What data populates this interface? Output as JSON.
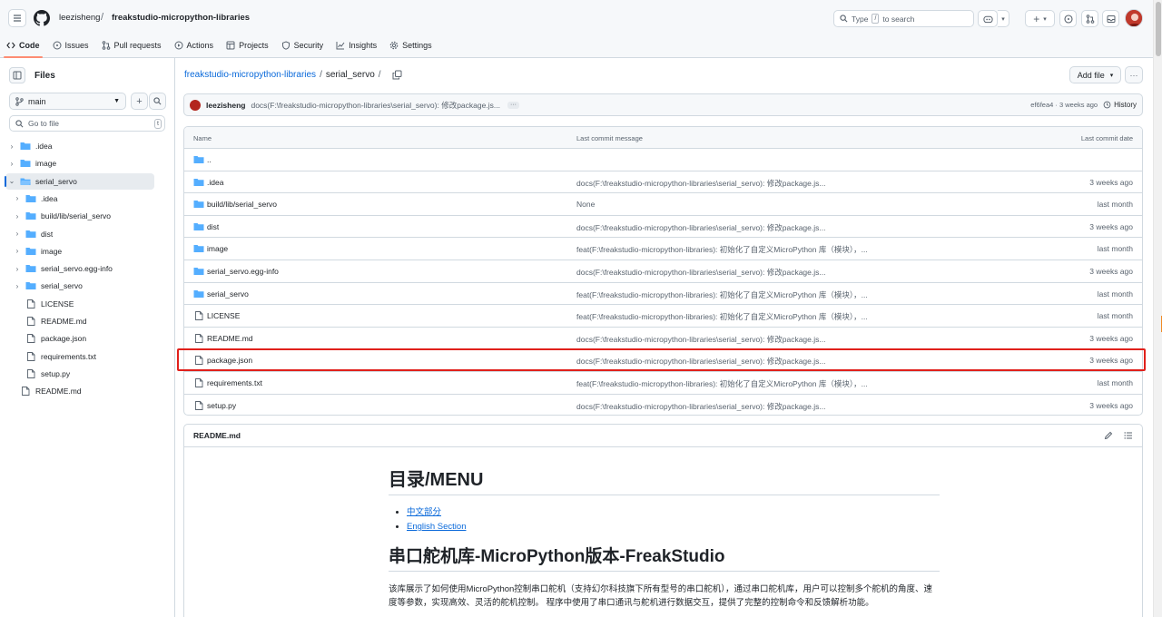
{
  "header": {
    "owner": "leezisheng",
    "separator": "/",
    "repo": "freakstudio-micropython-libraries",
    "search_prefix": "Type",
    "search_key": "/",
    "search_suffix": "to search"
  },
  "nav": [
    {
      "label": "Code",
      "icon": "code-icon",
      "active": true
    },
    {
      "label": "Issues",
      "icon": "issue-icon"
    },
    {
      "label": "Pull requests",
      "icon": "pull-request-icon"
    },
    {
      "label": "Actions",
      "icon": "play-icon"
    },
    {
      "label": "Projects",
      "icon": "table-icon"
    },
    {
      "label": "Security",
      "icon": "shield-icon"
    },
    {
      "label": "Insights",
      "icon": "graph-icon"
    },
    {
      "label": "Settings",
      "icon": "gear-icon"
    }
  ],
  "sidebar": {
    "title": "Files",
    "branch": "main",
    "goto_placeholder": "Go to file",
    "goto_key": "t",
    "tree": [
      {
        "label": ".idea",
        "type": "folder",
        "level": 0,
        "chevron": "›"
      },
      {
        "label": "image",
        "type": "folder",
        "level": 0,
        "chevron": "›"
      },
      {
        "label": "serial_servo",
        "type": "folder-open",
        "level": 0,
        "chevron": "⌄",
        "selected": true
      },
      {
        "label": ".idea",
        "type": "folder",
        "level": 1,
        "chevron": "›"
      },
      {
        "label": "build/lib/serial_servo",
        "type": "folder",
        "level": 1,
        "chevron": "›"
      },
      {
        "label": "dist",
        "type": "folder",
        "level": 1,
        "chevron": "›"
      },
      {
        "label": "image",
        "type": "folder",
        "level": 1,
        "chevron": "›"
      },
      {
        "label": "serial_servo.egg-info",
        "type": "folder",
        "level": 1,
        "chevron": "›"
      },
      {
        "label": "serial_servo",
        "type": "folder",
        "level": 1,
        "chevron": "›"
      },
      {
        "label": "LICENSE",
        "type": "file",
        "level": 1,
        "chevron": ""
      },
      {
        "label": "README.md",
        "type": "file",
        "level": 1,
        "chevron": ""
      },
      {
        "label": "package.json",
        "type": "file",
        "level": 1,
        "chevron": ""
      },
      {
        "label": "requirements.txt",
        "type": "file",
        "level": 1,
        "chevron": ""
      },
      {
        "label": "setup.py",
        "type": "file",
        "level": 1,
        "chevron": ""
      },
      {
        "label": "README.md",
        "type": "file",
        "level": 0,
        "chevron": ""
      }
    ]
  },
  "breadcrumb": {
    "repo_link": "freakstudio-micropython-libraries",
    "sep": "/",
    "current": "serial_servo",
    "trailing_sep": "/"
  },
  "toolbar": {
    "add_file": "Add file",
    "more": "···"
  },
  "latest_commit": {
    "author": "leezisheng",
    "message": "docs(F:\\freakstudio-micropython-libraries\\serial_servo): 修改package.js...",
    "dots": "···",
    "hash_time": "ef6fea4 · 3 weeks ago",
    "history_label": "History"
  },
  "table": {
    "headers": {
      "name": "Name",
      "message": "Last commit message",
      "date": "Last commit date"
    },
    "rows": [
      {
        "name": "..",
        "type": "folder",
        "message": "",
        "date": ""
      },
      {
        "name": ".idea",
        "type": "folder",
        "message": "docs(F:\\freakstudio-micropython-libraries\\serial_servo): 修改package.js...",
        "date": "3 weeks ago"
      },
      {
        "name": "build/lib/serial_servo",
        "type": "folder",
        "message": "None",
        "date": "last month"
      },
      {
        "name": "dist",
        "type": "folder",
        "message": "docs(F:\\freakstudio-micropython-libraries\\serial_servo): 修改package.js...",
        "date": "3 weeks ago"
      },
      {
        "name": "image",
        "type": "folder",
        "message": "feat(F:\\freakstudio-micropython-libraries): 初始化了自定义MicroPython 库（模块），...",
        "date": "last month"
      },
      {
        "name": "serial_servo.egg-info",
        "type": "folder",
        "message": "docs(F:\\freakstudio-micropython-libraries\\serial_servo): 修改package.js...",
        "date": "3 weeks ago"
      },
      {
        "name": "serial_servo",
        "type": "folder",
        "message": "feat(F:\\freakstudio-micropython-libraries): 初始化了自定义MicroPython 库（模块），...",
        "date": "last month"
      },
      {
        "name": "LICENSE",
        "type": "file",
        "message": "feat(F:\\freakstudio-micropython-libraries): 初始化了自定义MicroPython 库（模块），...",
        "date": "last month"
      },
      {
        "name": "README.md",
        "type": "file",
        "message": "docs(F:\\freakstudio-micropython-libraries\\serial_servo): 修改package.js...",
        "date": "3 weeks ago"
      },
      {
        "name": "package.json",
        "type": "file",
        "message": "docs(F:\\freakstudio-micropython-libraries\\serial_servo): 修改package.js...",
        "date": "3 weeks ago"
      },
      {
        "name": "requirements.txt",
        "type": "file",
        "message": "feat(F:\\freakstudio-micropython-libraries): 初始化了自定义MicroPython 库（模块），...",
        "date": "last month"
      },
      {
        "name": "setup.py",
        "type": "file",
        "message": "docs(F:\\freakstudio-micropython-libraries\\serial_servo): 修改package.js...",
        "date": "3 weeks ago"
      }
    ]
  },
  "readme": {
    "filename": "README.md",
    "menu_heading": "目录/MENU",
    "toc": [
      "中文部分",
      "English Section"
    ],
    "title": "串口舵机库-MicroPython版本-FreakStudio",
    "paragraph": "该库展示了如何使用MicroPython控制串口舵机（支持幻尔科技旗下所有型号的串口舵机），通过串口舵机库，用户可以控制多个舵机的角度、速度等参数，实现高效、灵活的舵机控制。 程序中使用了串口通讯与舵机进行数据交互，提供了完整的控制命令和反馈解析功能。"
  },
  "colors": {
    "accent": "#0969da",
    "nav_underline": "#fd8c73",
    "highlight_box": "#e0201b",
    "folder": "#54aeff"
  }
}
